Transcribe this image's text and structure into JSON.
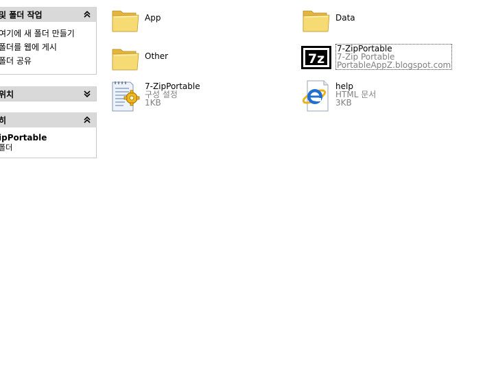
{
  "task_pane": {
    "file_tasks": {
      "title": "및 폴더 작업",
      "links": [
        "여기에 새 폴더 만들기",
        "폴더를 웹에 게시",
        "폴더 공유"
      ]
    },
    "other_places": {
      "title": "위치"
    },
    "details": {
      "title": "히",
      "name": "ipPortable",
      "type": "폴더"
    }
  },
  "files": [
    {
      "name": "App"
    },
    {
      "name": "Data"
    },
    {
      "name": "Other"
    },
    {
      "name": "7-ZipPortable",
      "line2": "7-Zip Portable",
      "line3": "PortableAppZ.blogspot.com"
    },
    {
      "name": "7-ZipPortable",
      "line2": "구성 설정",
      "line3": "1KB"
    },
    {
      "name": "help",
      "line2": "HTML 문서",
      "line3": "3KB"
    }
  ],
  "icons": {
    "folder": "folder-icon",
    "sevenzip": "7zip-app-icon",
    "ini": "config-settings-icon",
    "html": "internet-explorer-html-icon"
  },
  "colors": {
    "header_bg": "#d9d9d9",
    "secondary_text": "#808080",
    "folder_yellow": "#f5d86a"
  }
}
